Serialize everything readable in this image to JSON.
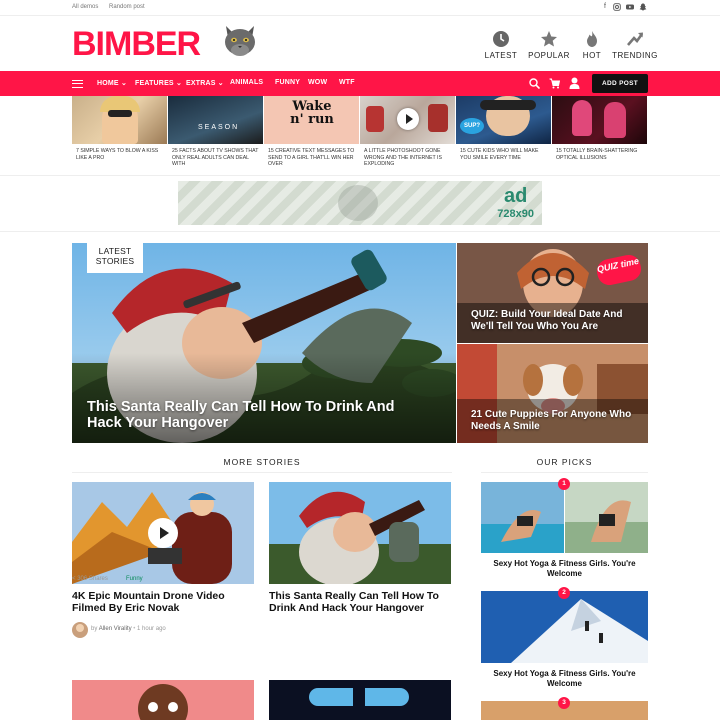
{
  "topbar": {
    "links": [
      "All demos",
      "Random post"
    ]
  },
  "brand": {
    "logo": "BIMBER",
    "accent": "#ff1547"
  },
  "header_nav": [
    {
      "label": "LATEST",
      "icon": "clock-icon"
    },
    {
      "label": "POPULAR",
      "icon": "star-icon"
    },
    {
      "label": "HOT",
      "icon": "flame-icon"
    },
    {
      "label": "TRENDING",
      "icon": "trending-arrow-icon"
    }
  ],
  "nav": {
    "items": [
      "HOME",
      "FEATURES",
      "EXTRAS",
      "ANIMALS",
      "FUNNY",
      "WOW",
      "WTF"
    ],
    "add_post": "ADD POST"
  },
  "strip": [
    "7 SIMPLE WAYS TO BLOW A KISS LIKE A PRO",
    "25 FACTS ABOUT TV SHOWS THAT ONLY REAL ADULTS CAN DEAL WITH",
    "15 CREATIVE TEXT MESSAGES TO SEND TO A GIRL THAT'LL WIN HER OVER",
    "A LITTLE PHOTOSHOOT GONE WRONG AND THE INTERNET IS EXPLODING",
    "15 CUTE KIDS WHO WILL MAKE YOU SMILE EVERY TIME",
    "15 TOTALLY BRAIN-SHATTERING OPTICAL ILLUSIONS"
  ],
  "strip_overlays": {
    "season": "SEASON",
    "wake": "Wake n' run",
    "sup": "SUP?"
  },
  "ad": {
    "line1": "ad",
    "line2": "728x90"
  },
  "hero": {
    "badge": "LATEST STORIES",
    "main_title": "This Santa Really Can Tell How To Drink And Hack Your Hangover",
    "side": [
      {
        "title": "QUIZ: Build Your Ideal Date And We'll Tell You Who You Are",
        "badge": "QUIZ time"
      },
      {
        "title": "21 Cute Puppies For Anyone Who Needs A Smile"
      }
    ]
  },
  "more_stories": {
    "heading": "MORE STORIES",
    "cards": [
      {
        "title": "4K Epic Mountain Drone Video Filmed By Eric Novak",
        "shares": "306 Shares",
        "tag": "Funny",
        "by": "by",
        "author": "Allen Virality",
        "time": "1 hour ago"
      },
      {
        "title": "This Santa Really Can Tell How To Drink And Hack Your Hangover"
      }
    ]
  },
  "our_picks": {
    "heading": "OUR PICKS",
    "items": [
      {
        "num": "1",
        "title": "Sexy Hot Yoga & Fitness Girls. You're Welcome"
      },
      {
        "num": "2",
        "title": "Sexy Hot Yoga & Fitness Girls. You're Welcome"
      },
      {
        "num": "3"
      }
    ]
  }
}
